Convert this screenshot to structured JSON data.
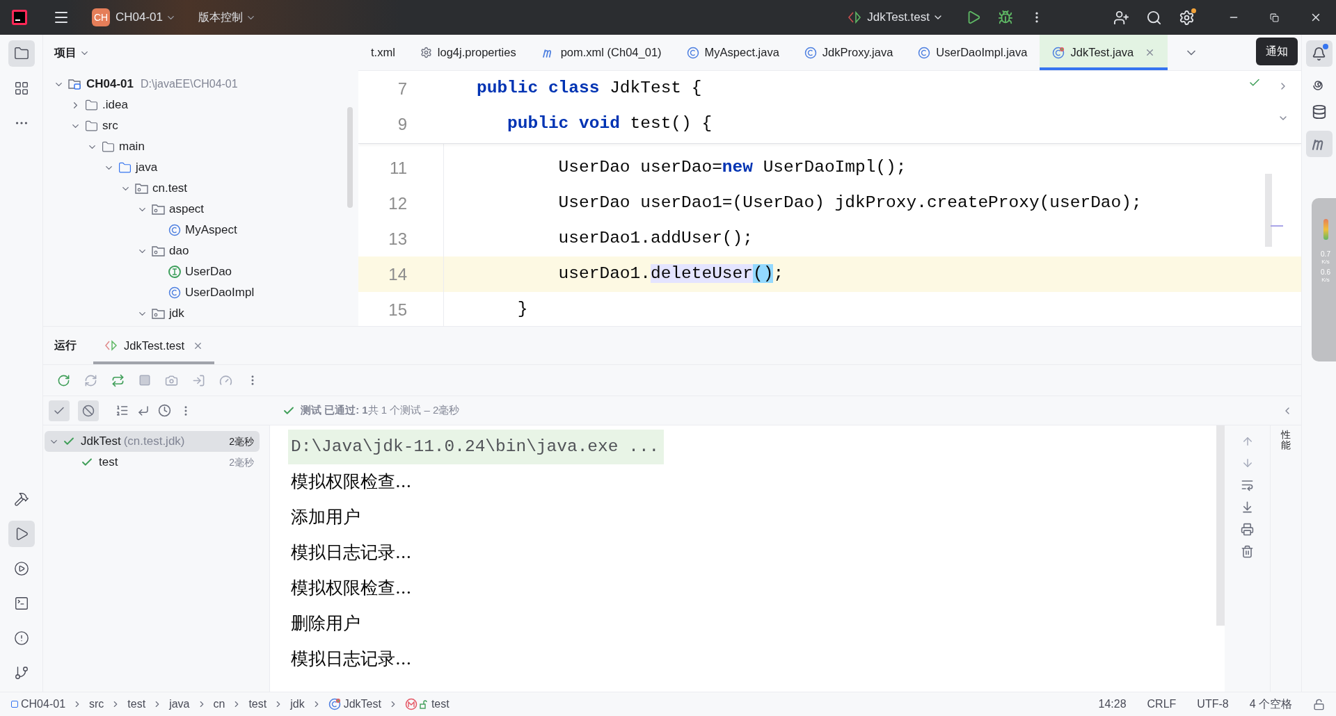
{
  "title_bar": {
    "project_badge": "CH",
    "project": "CH04-01",
    "vcs": "版本控制",
    "run_config": "JdkTest.test"
  },
  "left_toolbar": {
    "top": [
      {
        "kind": "project",
        "selected": true
      },
      {
        "kind": "structure",
        "selected": false
      },
      {
        "kind": "more",
        "selected": false
      }
    ],
    "bottom": [
      {
        "kind": "build",
        "selected": false
      },
      {
        "kind": "run",
        "selected": true
      },
      {
        "kind": "services",
        "selected": false
      },
      {
        "kind": "terminal",
        "selected": false
      },
      {
        "kind": "problems",
        "selected": false
      },
      {
        "kind": "git",
        "selected": false
      }
    ]
  },
  "project_panel": {
    "title": "项目",
    "tree": [
      {
        "name": "CH04-01",
        "path": "D:\\javaEE\\CH04-01",
        "kind": "module",
        "expanded": true,
        "children": [
          {
            "name": ".idea",
            "kind": "folder",
            "expanded": false
          },
          {
            "name": "src",
            "kind": "folder",
            "expanded": true,
            "children": [
              {
                "name": "main",
                "kind": "folder",
                "expanded": true,
                "children": [
                  {
                    "name": "java",
                    "kind": "source",
                    "expanded": true,
                    "children": [
                      {
                        "name": "cn.test",
                        "kind": "package",
                        "expanded": true,
                        "children": [
                          {
                            "name": "aspect",
                            "kind": "package",
                            "expanded": true,
                            "children": [
                              {
                                "name": "MyAspect",
                                "kind": "class"
                              }
                            ]
                          },
                          {
                            "name": "dao",
                            "kind": "package",
                            "expanded": true,
                            "children": [
                              {
                                "name": "UserDao",
                                "kind": "interface"
                              },
                              {
                                "name": "UserDaoImpl",
                                "kind": "class"
                              }
                            ]
                          },
                          {
                            "name": "jdk",
                            "kind": "package",
                            "expanded": true
                          }
                        ]
                      }
                    ]
                  }
                ]
              }
            ]
          }
        ]
      }
    ]
  },
  "editor_tabs": [
    {
      "label": "t.xml",
      "kind": "xml",
      "selected": false
    },
    {
      "label": "log4j.properties",
      "kind": "properties",
      "selected": false
    },
    {
      "label": "pom.xml (Ch04_01)",
      "kind": "maven",
      "selected": false
    },
    {
      "label": "MyAspect.java",
      "kind": "class",
      "selected": false
    },
    {
      "label": "JdkProxy.java",
      "kind": "class",
      "selected": false
    },
    {
      "label": "UserDaoImpl.java",
      "kind": "class",
      "selected": false
    },
    {
      "label": "JdkTest.java",
      "kind": "test",
      "selected": true
    }
  ],
  "notification_tooltip": "通知",
  "code_lines": [
    {
      "number": "7",
      "sticky": true,
      "current": false,
      "tokens": [
        {
          "text": "public class",
          "kind": "keyword"
        },
        {
          "text": " JdkTest {",
          "kind": "plain"
        }
      ]
    },
    {
      "number": "9",
      "sticky": true,
      "current": false,
      "tokens": [
        {
          "text": "   public void",
          "kind": "keyword"
        },
        {
          "text": " test() {",
          "kind": "plain"
        }
      ]
    },
    {
      "number": "11",
      "sticky": false,
      "current": false,
      "tokens": [
        {
          "text": "        UserDao userDao=",
          "kind": "plain"
        },
        {
          "text": "new",
          "kind": "keyword"
        },
        {
          "text": " UserDaoImpl();",
          "kind": "plain"
        }
      ]
    },
    {
      "number": "12",
      "sticky": false,
      "current": false,
      "tokens": [
        {
          "text": "        UserDao userDao1=(UserDao) jdkProxy.createProxy(userDao);",
          "kind": "plain"
        }
      ]
    },
    {
      "number": "13",
      "sticky": false,
      "current": false,
      "tokens": [
        {
          "text": "        userDao1.addUser();",
          "kind": "plain"
        }
      ]
    },
    {
      "number": "14",
      "sticky": false,
      "current": true,
      "tokens": [
        {
          "text": "        userDao1.",
          "kind": "plain"
        },
        {
          "text": "deleteUser",
          "kind": "usage"
        },
        {
          "text": "()",
          "kind": "brace-match"
        },
        {
          "text": ";",
          "kind": "plain"
        }
      ]
    },
    {
      "number": "15",
      "sticky": false,
      "current": false,
      "tokens": [
        {
          "text": "    }",
          "kind": "plain"
        }
      ]
    }
  ],
  "net_monitor": {
    "up": "0.7",
    "up_unit": "K/s",
    "down": "0.6",
    "down_unit": "K/s"
  },
  "run_panel": {
    "title": "运行",
    "tabs": [
      {
        "label": "JdkTest.test",
        "selected": true
      }
    ],
    "filters": [
      {
        "kind": "passed",
        "on": true
      },
      {
        "kind": "ignored",
        "on": true
      }
    ],
    "status": "**测试 已通过: 1**共 1 个测试 – 2毫秒",
    "tests": [
      {
        "name": "JdkTest",
        "package": "(cn.test.jdk)",
        "time": "2毫秒",
        "passed": true,
        "selected": true,
        "expanded": true,
        "children": [
          {
            "name": "test",
            "time": "2毫秒",
            "passed": true,
            "selected": false
          }
        ]
      }
    ],
    "console": [
      {
        "text": "D:\\Java\\jdk-11.0.24\\bin\\java.exe ...",
        "kind": "command"
      },
      {
        "text": "模拟权限检查...",
        "kind": "output"
      },
      {
        "text": "添加用户",
        "kind": "output"
      },
      {
        "text": "模拟日志记录...",
        "kind": "output"
      },
      {
        "text": "模拟权限检查...",
        "kind": "output"
      },
      {
        "text": "删除用户",
        "kind": "output"
      },
      {
        "text": "模拟日志记录...",
        "kind": "output"
      }
    ],
    "side_label": "性能"
  },
  "status_bar": {
    "breadcrumbs": [
      {
        "label": "CH04-01",
        "kind": "module"
      },
      {
        "label": "src",
        "kind": "plain"
      },
      {
        "label": "test",
        "kind": "plain"
      },
      {
        "label": "java",
        "kind": "plain"
      },
      {
        "label": "cn",
        "kind": "plain"
      },
      {
        "label": "test",
        "kind": "plain"
      },
      {
        "label": "jdk",
        "kind": "plain"
      },
      {
        "label": "JdkTest",
        "kind": "test"
      },
      {
        "label": "test",
        "kind": "method"
      }
    ],
    "items": [
      "14:28",
      "CRLF",
      "UTF-8",
      "4 个空格"
    ]
  }
}
